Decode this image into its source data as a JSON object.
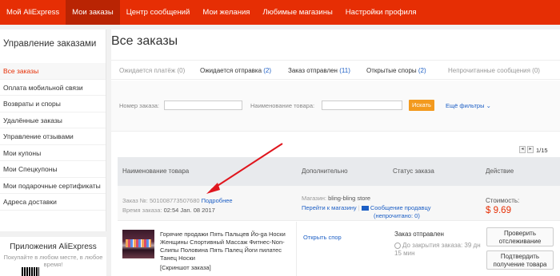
{
  "nav": [
    "Мой AliExpress",
    "Мои заказы",
    "Центр сообщений",
    "Мои желания",
    "Любимые магазины",
    "Настройки профиля"
  ],
  "sidebar": {
    "title": "Управление заказами",
    "items": [
      "Все заказы",
      "Оплата мобильной связи",
      "Возвраты и споры",
      "Удалённые заказы",
      "Управление отзывами",
      "Мои купоны",
      "Мои Спецкупоны",
      "Мои подарочные сертификаты",
      "Адреса доставки"
    ]
  },
  "promo": {
    "title": "Приложения AliExpress",
    "subtitle": "Покупайте в любом месте, в любое время!"
  },
  "page_title": "Все заказы",
  "tabs": [
    {
      "label": "Ожидается платёж",
      "count": "(0)"
    },
    {
      "label": "Ожидается отправка",
      "count": "(2)"
    },
    {
      "label": "Заказ отправлен",
      "count": "(11)"
    },
    {
      "label": "Открытые споры",
      "count": "(2)"
    },
    {
      "label": "Непрочитанные сообщения",
      "count": "(0)"
    }
  ],
  "filter": {
    "order_label": "Номер заказа:",
    "product_label": "Наименование товара:",
    "search_button": "Искать",
    "more_filters": "Ещё фильтры"
  },
  "pager": {
    "text": "1/15"
  },
  "table_headers": [
    "Наименование товара",
    "Дополнительно",
    "Статус заказа",
    "Действие"
  ],
  "order": {
    "number_label": "Заказ №:",
    "number": "501008773507680",
    "details_link": "Подробнее",
    "time_label": "Время заказа:",
    "time": "02:54 Jan. 08 2017",
    "store_label": "Магазин:",
    "store": "bling-bling store",
    "go_store": "Перейти к магазину",
    "contact_seller": "Сообщение продавцу",
    "unread": "(непрочитано: 0)",
    "price_label": "Стоимость:",
    "price": "$ 9.69"
  },
  "item": {
    "title": "Горячие продажи Пять Пальцев Йо-ga Носки Женщины Спортивный Массаж Фитнес-Non-Слипы Половина Пять Палец Йоги пилатес Танец Носки",
    "snapshot": "[Скриншот заказа]",
    "open_dispute": "Открыть спор",
    "status": "Заказ отправлен",
    "timer": "До закрытия заказа: 39 дн 15 мин",
    "btn_track": "Проверить отслеживание",
    "btn_confirm": "Подтвердить получение товара"
  },
  "colors": {
    "brand": "#e62e04",
    "link": "#1d5fc5",
    "button": "#f39a1e"
  }
}
